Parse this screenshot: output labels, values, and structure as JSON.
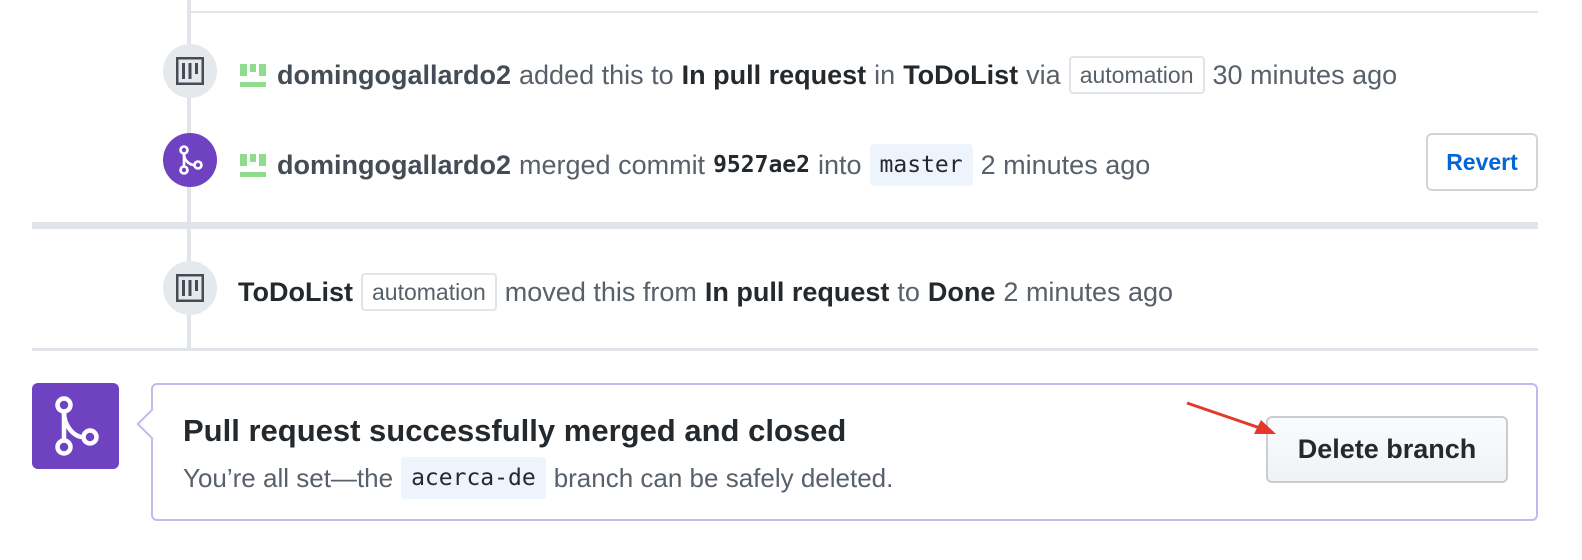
{
  "events": [
    {
      "actor": "domingogallardo2",
      "text_added": "added this to",
      "column": "In pull request",
      "text_in": "in",
      "project": "ToDoList",
      "text_via": "via",
      "automation_label": "automation",
      "time": "30 minutes ago",
      "icon": "project-icon"
    },
    {
      "actor": "domingogallardo2",
      "text_merged": "merged commit",
      "commit": "9527ae2",
      "text_into": "into",
      "branch": "master",
      "time": "2 minutes ago",
      "icon": "merge-icon",
      "revert_label": "Revert"
    },
    {
      "project": "ToDoList",
      "automation_label": "automation",
      "text_moved": "moved this from",
      "from_column": "In pull request",
      "text_to": "to",
      "to_column": "Done",
      "time": "2 minutes ago",
      "icon": "project-icon"
    }
  ],
  "merge_box": {
    "title": "Pull request successfully merged and closed",
    "desc_before": "You’re all set—the",
    "branch": "acerca-de",
    "desc_after": "branch can be safely deleted.",
    "delete_label": "Delete branch",
    "icon": "merge-icon"
  },
  "colors": {
    "merged_purple": "#6f42c1",
    "link_blue": "#0366d6",
    "arrow_red": "#e5372a",
    "avatar_green": "#8fdc8f"
  }
}
